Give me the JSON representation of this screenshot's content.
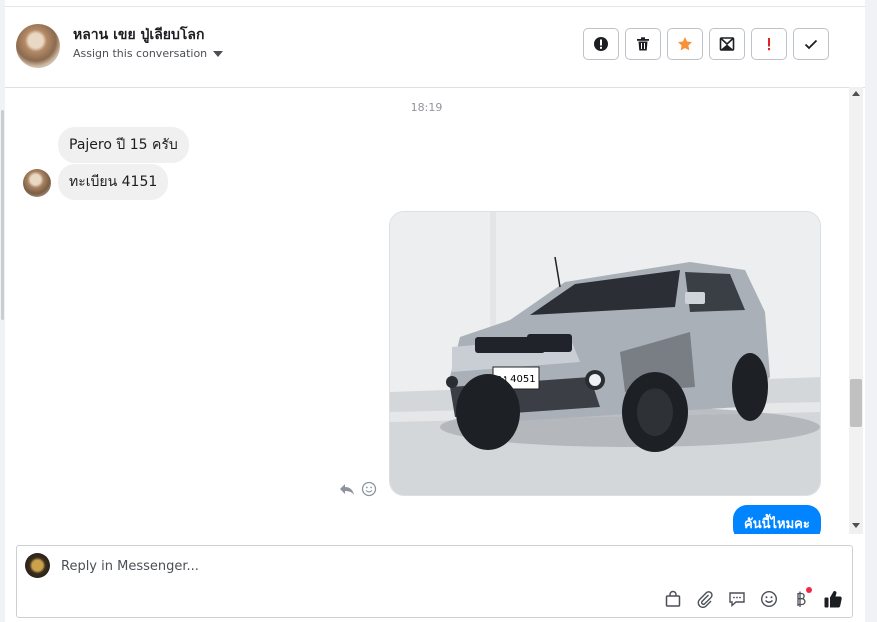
{
  "header": {
    "contact_name": "หลาน เขย ปู่เลียบโลก",
    "assign_label": "Assign this conversation",
    "actions": [
      {
        "name": "mark-spam-button",
        "icon": "alert-circle-icon",
        "color": "#1c1e21"
      },
      {
        "name": "delete-button",
        "icon": "trash-icon",
        "color": "#1c1e21"
      },
      {
        "name": "star-button",
        "icon": "star-icon",
        "color": "#f7923b"
      },
      {
        "name": "mark-unread-button",
        "icon": "envelope-icon",
        "color": "#1c1e21"
      },
      {
        "name": "important-button",
        "icon": "exclamation-icon",
        "color": "#e02424"
      },
      {
        "name": "done-button",
        "icon": "check-icon",
        "color": "#1c1e21"
      }
    ]
  },
  "thread": {
    "timestamp": "18:19",
    "incoming": [
      "Pajero ปี 15 ครับ",
      "ทะเบียน 4151"
    ],
    "image": {
      "plate_line1": "กง 4051",
      "description_icon": "car-photo"
    },
    "outgoing": [
      "คันนี้ไหมคะ"
    ]
  },
  "composer": {
    "placeholder": "Reply in Messenger...",
    "tools": [
      "shop-bag-icon",
      "attachment-icon",
      "saved-reply-icon",
      "emoji-icon",
      "baht-payment-icon",
      "like-icon"
    ]
  },
  "colors": {
    "accent": "#0084ff",
    "notification": "#f02849"
  }
}
